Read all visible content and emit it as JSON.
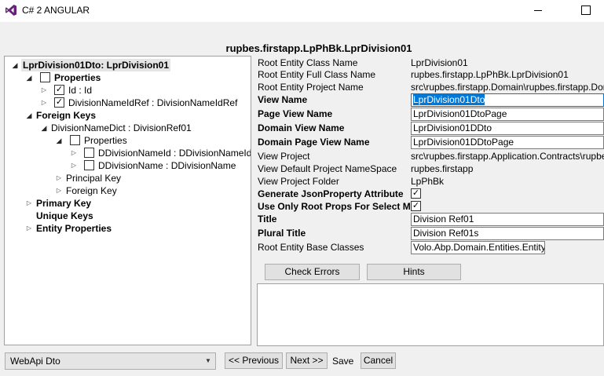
{
  "window": {
    "title": "C# 2 ANGULAR",
    "brand_color": "#68217a"
  },
  "entity_title": "rupbes.firstapp.LpPhBk.LprDivision01",
  "tree": {
    "root": "LprDivision01Dto: LprDivision01",
    "properties": "Properties",
    "id": "Id : Id",
    "division_name_id_ref": "DivisionNameIdRef : DivisionNameIdRef",
    "foreign_keys": "Foreign Keys",
    "division_name_dict": "DivisionNameDict : DivisionRef01",
    "sub_properties": "Properties",
    "ddivision_name_id": "DDivisionNameId : DDivisionNameId",
    "ddivision_name": "DDivisionName : DDivisionName",
    "principal_key": "Principal Key",
    "sub_foreign_key": "Foreign Key",
    "primary_key": "Primary Key",
    "unique_keys": "Unique Keys",
    "entity_properties": "Entity Properties"
  },
  "form": {
    "root_entity_class_name_label": "Root Entity Class Name",
    "root_entity_class_name": "LprDivision01",
    "root_entity_full_class_name_label": "Root Entity Full Class Name",
    "root_entity_full_class_name": "rupbes.firstapp.LpPhBk.LprDivision01",
    "root_entity_project_name_label": "Root Entity Project Name",
    "root_entity_project_name": "src\\rupbes.firstapp.Domain\\rupbes.firstapp.Domain.csproj",
    "view_name_label": "View Name",
    "view_name": "LprDivision01Dto",
    "page_view_name_label": "Page View Name",
    "page_view_name": "LprDivision01DtoPage",
    "domain_view_name_label": "Domain View Name",
    "domain_view_name": "LprDivision01DDto",
    "domain_page_view_name_label": "Domain Page View Name",
    "domain_page_view_name": "LprDivision01DDtoPage",
    "view_project_label": "View Project",
    "view_project": "src\\rupbes.firstapp.Application.Contracts\\rupbes.firstapp.Application.Contracts.csproj",
    "view_default_namespace_label": "View Default Project NameSpace",
    "view_default_namespace": "rupbes.firstapp",
    "view_project_folder_label": "View Project Folder",
    "view_project_folder": "LpPhBk",
    "generate_json_label": "Generate JsonProperty Attribute",
    "generate_json_checked": true,
    "use_only_root_label": "Use Only Root Props For Select Method",
    "use_only_root_checked": true,
    "title_label": "Title",
    "title": "Division Ref01",
    "plural_title_label": "Plural Title",
    "plural_title": "Division Ref01s",
    "root_entity_base_classes_label": "Root Entity Base Classes",
    "root_entity_base_classes": "Volo.Abp.Domain.Entities.Entity"
  },
  "buttons": {
    "check_errors": "Check Errors",
    "hints": "Hints",
    "previous": "<< Previous",
    "next": "Next >>",
    "save": "Save",
    "cancel": "Cancel"
  },
  "bottom": {
    "selected_option": "WebApi Dto"
  }
}
